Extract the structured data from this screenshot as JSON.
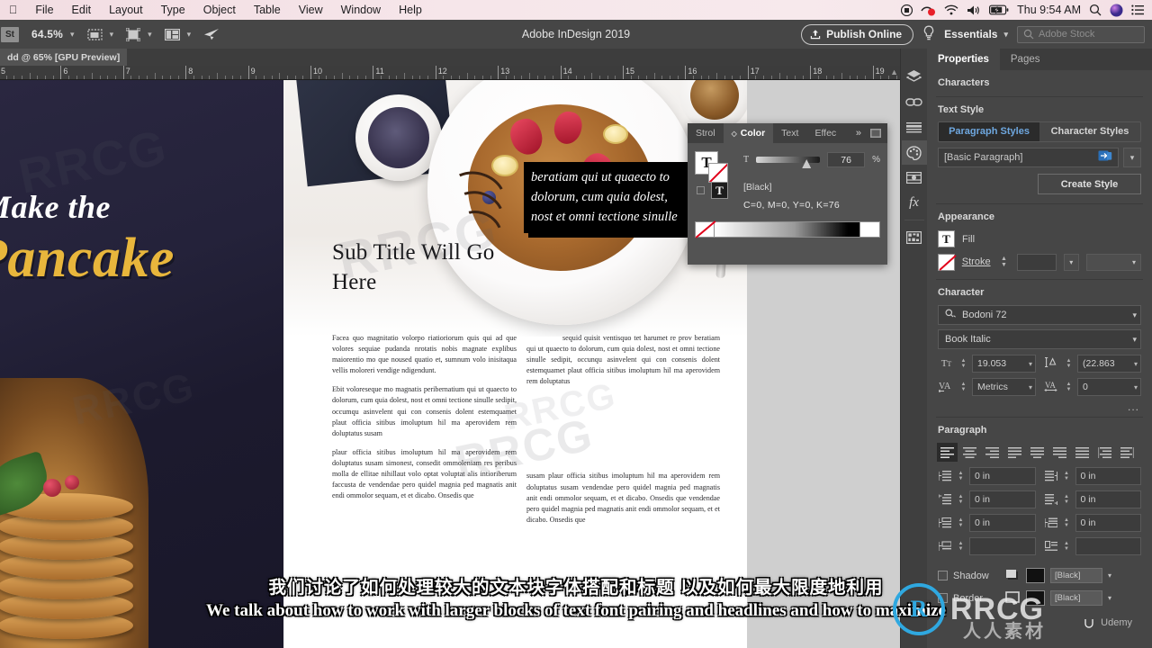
{
  "macbar": {
    "items": [
      "File",
      "Edit",
      "Layout",
      "Type",
      "Object",
      "Table",
      "View",
      "Window",
      "Help"
    ],
    "clock": "Thu 9:54 AM",
    "icons": [
      "record-icon",
      "screen-share-icon",
      "wifi-icon",
      "volume-icon",
      "battery-charging-icon",
      "spotlight-search-icon",
      "siri-icon",
      "control-center-icon"
    ]
  },
  "appbar": {
    "st_badge": "St",
    "zoom_level": "64.5%",
    "title": "Adobe InDesign 2019",
    "publish_label": "Publish Online",
    "workspace": "Essentials",
    "stock_placeholder": "Adobe Stock",
    "icons": [
      "screen-mode-icon",
      "view-options-icon",
      "arrange-documents-icon",
      "share-icon",
      "lightbulb-icon",
      "search-icon"
    ]
  },
  "document": {
    "tab_label": "dd @ 65% [GPU Preview]",
    "ruler_units": [
      "5",
      "6",
      "7",
      "8",
      "9",
      "10",
      "11",
      "12",
      "13",
      "14",
      "15",
      "16",
      "17",
      "18",
      "19"
    ],
    "left_page": {
      "headline_top": "Make the",
      "headline_main": "Pancake"
    },
    "right_page": {
      "subtitle": "Sub Title Will Go Here",
      "column_left": [
        "Facea quo magnitatio volorpo riatioriorum quis qui ad que volores sequiae pudanda nrotatis nobis magnate explibus maiorentio mo que noused quatio et, sumnum volo inisitaqua vellis moloreri vendige ndigendunt.",
        "Ebit voloreseque mo magnatis peribernatium qui ut quaecto to dolorum, cum quia dolest, nost et omni tectione sinulle sedipit, occumqu asinvelent qui con consenis dolent estemquamet plaut officia sitibus imoluptum hil ma aperovidem rem doluptatus susam",
        "plaur officia sitibus imoluptum hil ma aperovidem rem doluptatus susam simonest, consedit ommoleniam res peribus molla de ellitae nihillaut volo optat voluptat alis intioriberum faccusta de vendendae pero quidel magnia ped magnatis anit endi ommolor sequam, et et dicabo. Onsedis que"
      ],
      "column_right_top": "sequid quisit ventisquo tet harumet re prov beratiam qui ut quaecto to dolorum, cum quia dolest, nost et omni tectione sinulle sedipit, occunqu asinvelent qui con consenis dolent estemquamet plaut officia sitibus imoluptum hil ma aperovidem rem doluptatus",
      "pull_quote": "beratiam qui ut quaecto to dolorum, cum quia dolest, nost et omni tectione sinulle",
      "column_right_bottom": "susam plaur officia sitibus imoluptum hil ma aperovidem rem doluptatus susam vendendae pero quidel magnia ped magnatis anit endi ommolor sequam, et et dicabo. Onsedis que vendendae pero quidel magnia ped magnatis anit endi ommolor sequam, et et dicabo. Onsedis que"
    }
  },
  "color_panel": {
    "tabs": [
      "Strol",
      "Color",
      "Text",
      "Effec"
    ],
    "active_tab": "Color",
    "tint_label": "T",
    "tint_value": "76",
    "tint_unit": "%",
    "swatch_name": "[Black]",
    "cmyk": "C=0, M=0, Y=0, K=76"
  },
  "rail": {
    "items": [
      "layers-icon",
      "links-icon",
      "paragraph-styles-icon",
      "color-icon",
      "stroke-icon",
      "effects-fx-icon",
      "object-states-icon"
    ],
    "active": "color-icon"
  },
  "properties": {
    "tabs": [
      "Properties",
      "Pages"
    ],
    "active_tab": "Properties",
    "context_label": "Characters",
    "text_style": {
      "title": "Text Style",
      "segmented": [
        "Paragraph Styles",
        "Character Styles"
      ],
      "active_segment": "Paragraph Styles",
      "style_value": "[Basic Paragraph]",
      "create_button": "Create Style"
    },
    "appearance": {
      "title": "Appearance",
      "fill_label": "Fill",
      "stroke_label": "Stroke"
    },
    "character": {
      "title": "Character",
      "font_family": "Bodoni 72",
      "font_style": "Book Italic",
      "font_size": "19.053",
      "leading": "(22.863",
      "kerning": "Metrics",
      "tracking": "0",
      "more_label": "..."
    },
    "paragraph": {
      "title": "Paragraph",
      "align_icons": [
        "align-left-icon",
        "align-center-icon",
        "align-right-icon",
        "justify-last-left-icon",
        "justify-last-center-icon",
        "justify-last-right-icon",
        "justify-all-icon",
        "align-toward-spine-icon",
        "align-away-spine-icon"
      ],
      "active_align": "align-left-icon",
      "indents": [
        {
          "icon": "left-indent-icon",
          "value": "0 in"
        },
        {
          "icon": "right-indent-icon",
          "value": "0 in"
        },
        {
          "icon": "first-line-indent-icon",
          "value": "0 in"
        },
        {
          "icon": "last-line-indent-icon",
          "value": "0 in"
        },
        {
          "icon": "space-before-icon",
          "value": "0 in"
        },
        {
          "icon": "space-after-icon",
          "value": "0 in"
        }
      ]
    },
    "bottom": {
      "shadow_label": "Shadow",
      "border_label": "Border",
      "shadow_color": "[Black]",
      "border_color": "[Black]"
    }
  },
  "subtitles": {
    "chinese": "我们讨论了如何处理较大的文本块字体搭配和标题 以及如何最大限度地利用",
    "english": "We talk about how to work with larger blocks of text font pairing and headlines and how to maximize"
  },
  "watermarks": {
    "brand": "RRCG",
    "brand_cn": "人人素材",
    "logo_letter": "R",
    "udemy": "Udemy"
  },
  "colors": {
    "accent_blue": "#6fa8e0",
    "panel_bg": "#464646",
    "appbar_bg": "#464646",
    "menubar_bg": "#f4e3e8",
    "gold": "#e8b63c"
  }
}
